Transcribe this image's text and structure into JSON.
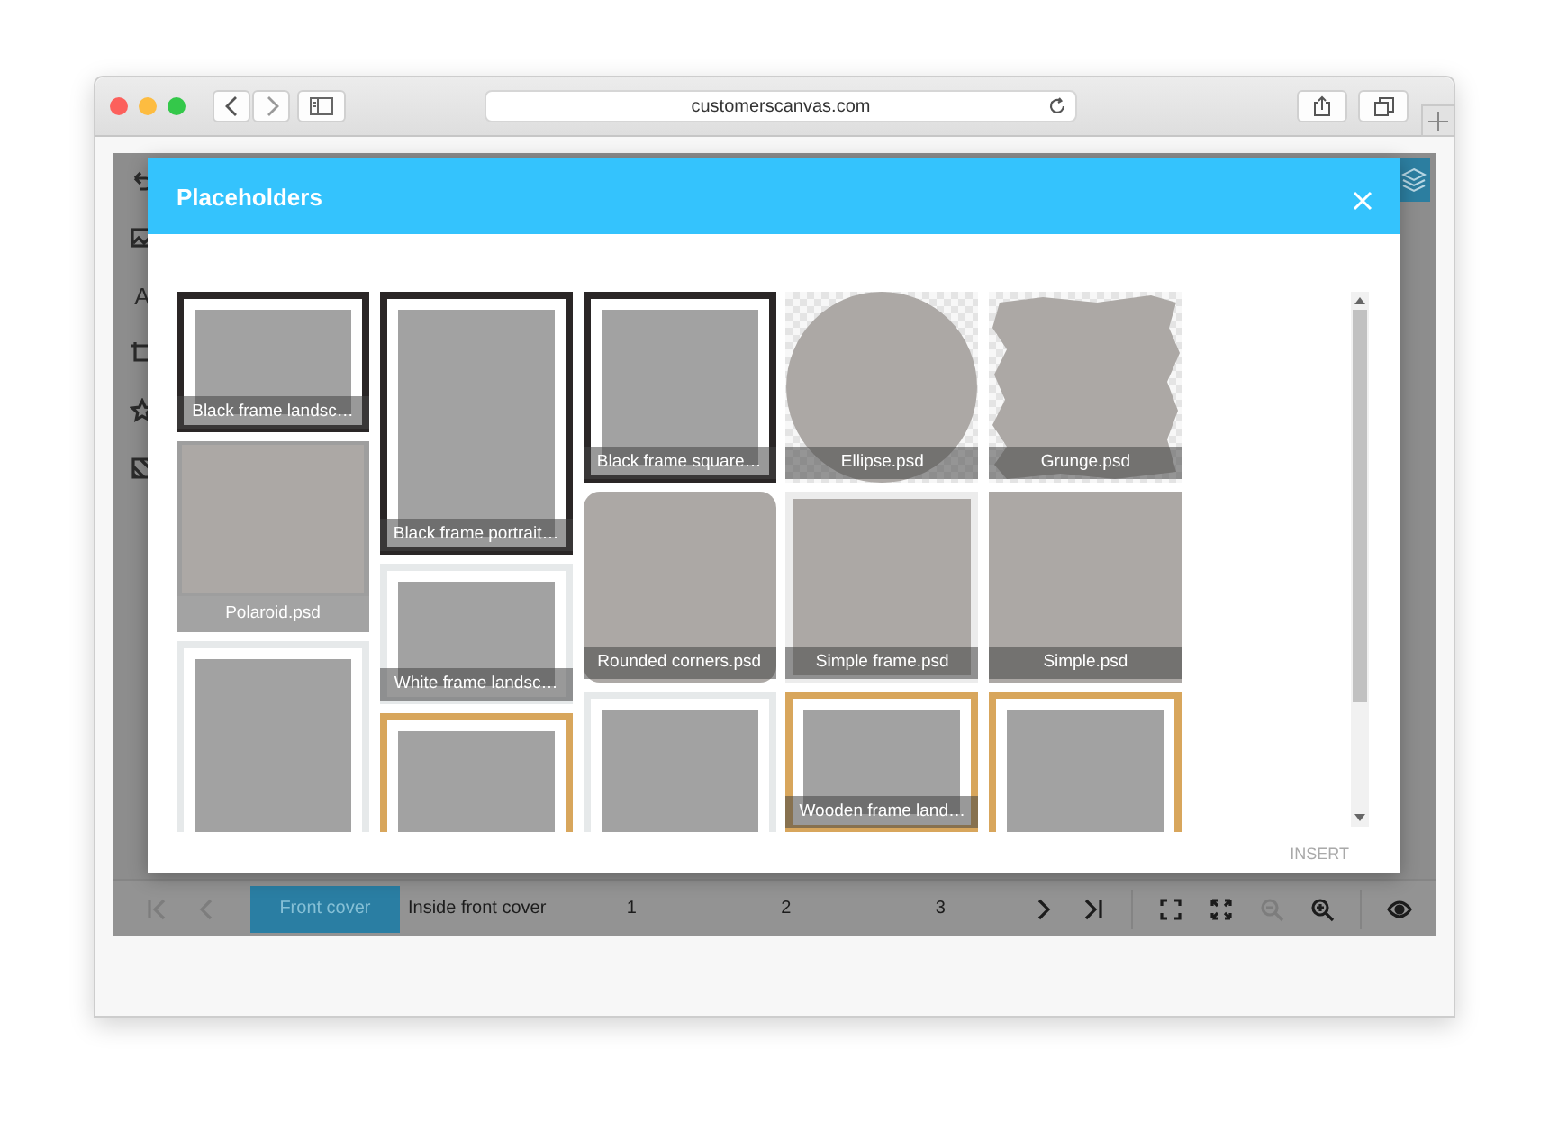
{
  "browser": {
    "url": "customerscanvas.com"
  },
  "tools": [
    {
      "kind": "undo"
    },
    {
      "kind": "image"
    },
    {
      "kind": "text",
      "label": "A"
    },
    {
      "kind": "crop"
    },
    {
      "kind": "star"
    },
    {
      "kind": "pattern"
    }
  ],
  "dialog": {
    "title": "Placeholders",
    "columns": [
      {
        "tiles": [
          {
            "kind": "dark-frame-landscape",
            "label": "Black frame landsc…"
          },
          {
            "kind": "polaroid",
            "label": "Polaroid.psd"
          },
          {
            "kind": "light-frame-portrait"
          }
        ]
      },
      {
        "tiles": [
          {
            "kind": "dark-frame-portrait",
            "label": "Black frame portrait…"
          },
          {
            "kind": "light-frame-landscape",
            "label": "White frame landsc…"
          },
          {
            "kind": "wood-frame-portrait"
          }
        ]
      },
      {
        "tiles": [
          {
            "kind": "dark-frame-square",
            "label": "Black frame square…"
          },
          {
            "kind": "rounded",
            "label": "Rounded corners.psd"
          },
          {
            "kind": "light-frame-portrait"
          }
        ]
      },
      {
        "tiles": [
          {
            "kind": "ellipse",
            "label": "Ellipse.psd"
          },
          {
            "kind": "simple-frame",
            "label": "Simple frame.psd"
          },
          {
            "kind": "wood-frame-landscape",
            "label": "Wooden frame land…"
          }
        ]
      },
      {
        "tiles": [
          {
            "kind": "grunge",
            "label": "Grunge.psd"
          },
          {
            "kind": "simple",
            "label": "Simple.psd"
          },
          {
            "kind": "wood-frame-portrait"
          }
        ]
      }
    ],
    "insert_button": {
      "label": "INSERT",
      "disabled": true
    }
  },
  "pager": {
    "nav_start": [
      {
        "kind": "first",
        "disabled": true
      },
      {
        "kind": "prev",
        "disabled": true
      }
    ],
    "pages": [
      {
        "label": "Front cover",
        "selected": true
      },
      {
        "label": "Inside front cover",
        "selected": false
      },
      {
        "label": "1",
        "selected": false
      },
      {
        "label": "2",
        "selected": false
      },
      {
        "label": "3",
        "selected": false
      }
    ],
    "nav_end": [
      {
        "kind": "next",
        "disabled": false
      },
      {
        "kind": "last",
        "disabled": false
      }
    ],
    "view_tools": [
      {
        "kind": "fit",
        "disabled": false
      },
      {
        "kind": "fullscreen",
        "disabled": false
      },
      {
        "kind": "zoom-out",
        "disabled": true
      },
      {
        "kind": "zoom-in",
        "disabled": false
      }
    ],
    "preview": {
      "kind": "eye",
      "disabled": false
    }
  }
}
